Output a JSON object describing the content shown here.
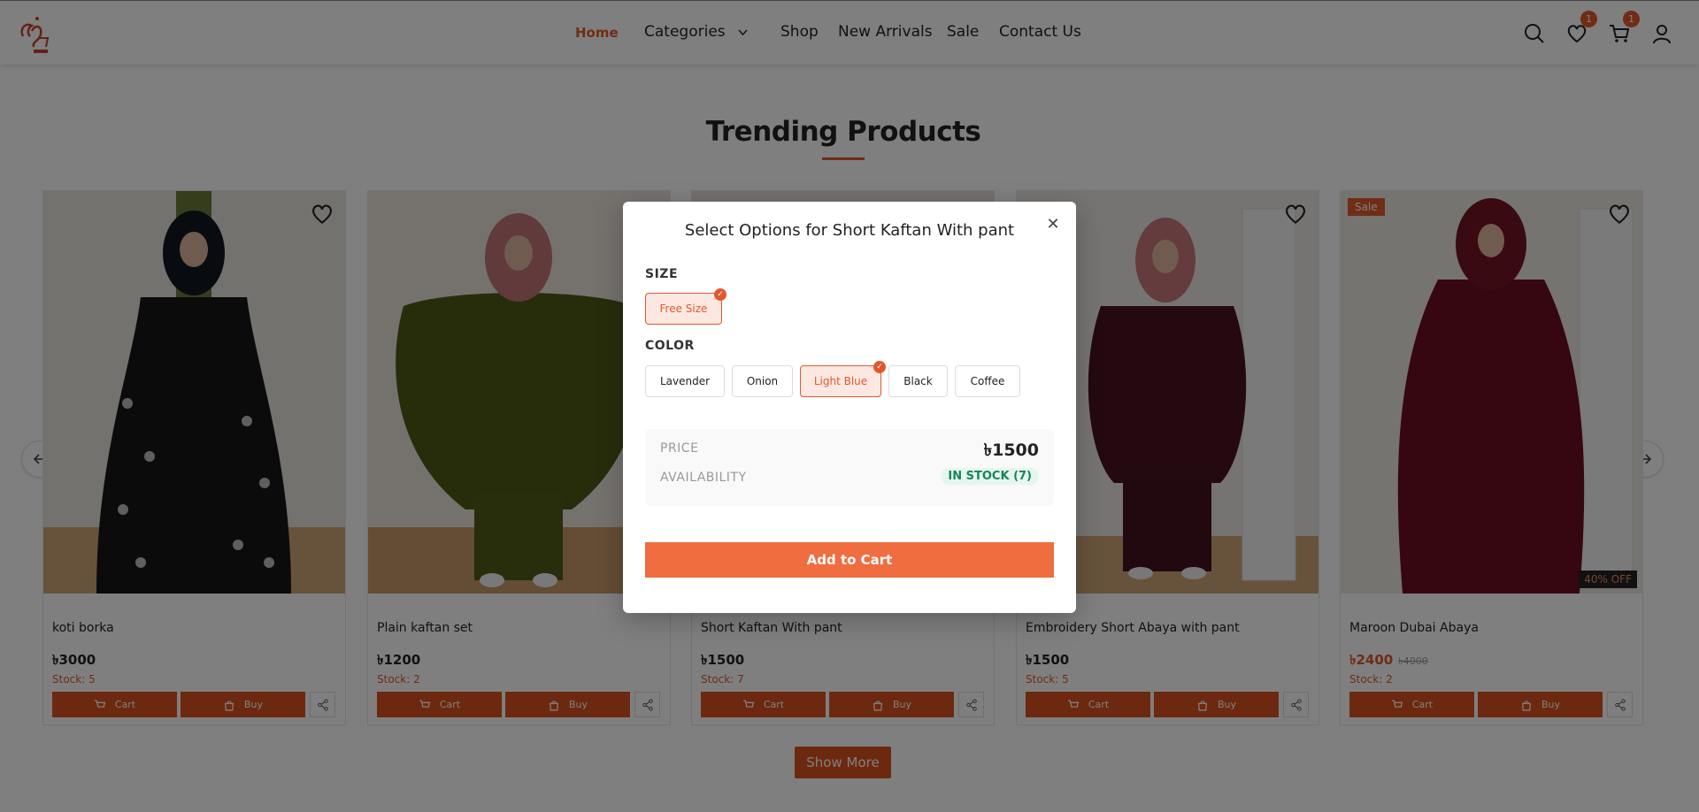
{
  "header": {
    "nav": [
      {
        "label": "Home",
        "active": true
      },
      {
        "label": "Categories"
      },
      {
        "label": "Shop"
      },
      {
        "label": "New Arrivals"
      },
      {
        "label": "Sale"
      },
      {
        "label": "Contact Us"
      }
    ],
    "wishlist_count": "1",
    "cart_count": "1"
  },
  "section": {
    "title": "Trending Products",
    "show_more": "Show More"
  },
  "products": [
    {
      "name": "koti borka",
      "price": "৳3000",
      "stock": "Stock: 5",
      "cart": "Cart",
      "buy": "Buy"
    },
    {
      "name": "Plain kaftan set",
      "price": "৳1200",
      "stock": "Stock: 2",
      "cart": "Cart",
      "buy": "Buy"
    },
    {
      "name": "Short Kaftan With pant",
      "price": "৳1500",
      "stock": "Stock: 7",
      "cart": "Cart",
      "buy": "Buy"
    },
    {
      "name": "Embroidery Short Abaya with pant",
      "price": "৳1500",
      "stock": "Stock: 5",
      "cart": "Cart",
      "buy": "Buy"
    },
    {
      "name": "Maroon Dubai Abaya",
      "price": "৳2400",
      "old_price": "৳4000",
      "stock": "Stock: 2",
      "cart": "Cart",
      "buy": "Buy",
      "sale_badge": "Sale",
      "discount": "40% OFF"
    }
  ],
  "modal": {
    "title": "Select Options for Short Kaftan With pant",
    "size_label": "SIZE",
    "sizes": [
      "Free Size"
    ],
    "selected_size": "Free Size",
    "color_label": "COLOR",
    "colors": [
      "Lavender",
      "Onion",
      "Light Blue",
      "Black",
      "Coffee"
    ],
    "selected_color": "Light Blue",
    "price_label": "PRICE",
    "price": "৳1500",
    "availability_label": "AVAILABILITY",
    "availability": "IN STOCK (7)",
    "add_to_cart": "Add to Cart"
  },
  "colors": {
    "accent": "#e2582d",
    "button": "#d9531f",
    "add_to_cart": "#f06d3f",
    "in_stock": "#17855f"
  }
}
